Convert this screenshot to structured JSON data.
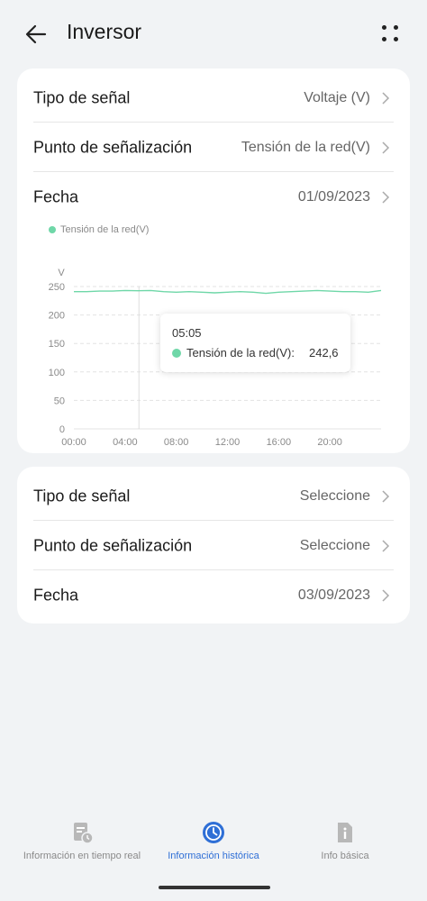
{
  "header": {
    "title": "Inversor"
  },
  "card1": {
    "rows": [
      {
        "label": "Tipo de señal",
        "value": "Voltaje (V)"
      },
      {
        "label": "Punto de señalización",
        "value": "Tensión de la red(V)"
      },
      {
        "label": "Fecha",
        "value": "01/09/2023"
      }
    ]
  },
  "chart_data": {
    "type": "line",
    "title": "",
    "xlabel": "",
    "ylabel": "V",
    "ylim": [
      0,
      250
    ],
    "xlim_hours": [
      0,
      24
    ],
    "x_ticks": [
      "00:00",
      "04:00",
      "08:00",
      "12:00",
      "16:00",
      "20:00"
    ],
    "y_ticks": [
      "0",
      "50",
      "100",
      "150",
      "200",
      "250"
    ],
    "legend_position": "top-left",
    "grid": true,
    "series": [
      {
        "name": "Tensión de la red(V)",
        "color": "#6fd7a8",
        "x": [
          "00:00",
          "01:00",
          "02:00",
          "03:00",
          "04:00",
          "05:00",
          "06:00",
          "07:00",
          "08:00",
          "09:00",
          "10:00",
          "11:00",
          "12:00",
          "13:00",
          "14:00",
          "15:00",
          "16:00",
          "17:00",
          "18:00",
          "19:00",
          "20:00",
          "21:00",
          "22:00",
          "23:00",
          "24:00"
        ],
        "values": [
          241,
          241,
          242,
          242,
          243,
          242.6,
          243,
          241,
          240,
          241,
          240,
          239,
          240,
          241,
          240,
          238,
          240,
          241,
          242,
          243,
          242,
          241,
          241,
          240,
          243
        ]
      }
    ],
    "tooltip": {
      "time": "05:05",
      "series": "Tensión de la red(V)",
      "value": "242,6"
    }
  },
  "card2": {
    "rows": [
      {
        "label": "Tipo de señal",
        "value": "Seleccione"
      },
      {
        "label": "Punto de señalización",
        "value": "Seleccione"
      },
      {
        "label": "Fecha",
        "value": "03/09/2023"
      }
    ]
  },
  "bottom_nav": {
    "items": [
      {
        "label": "Información en tiempo real",
        "icon": "realtime-doc-icon",
        "active": false
      },
      {
        "label": "Información histórica",
        "icon": "history-clock-icon",
        "active": true
      },
      {
        "label": "Info básica",
        "icon": "info-doc-icon",
        "active": false
      }
    ]
  },
  "colors": {
    "accent": "#2f6fd6",
    "series": "#6fd7a8",
    "background": "#f1f3f5"
  }
}
